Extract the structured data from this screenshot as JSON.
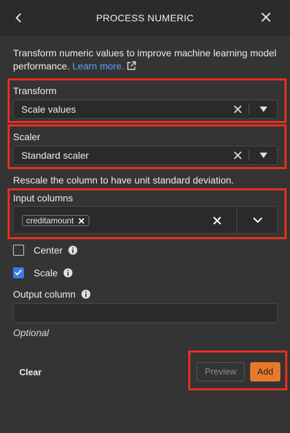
{
  "header": {
    "title": "PROCESS NUMERIC",
    "back_icon": "chevron-left-icon",
    "close_icon": "close-icon"
  },
  "intro": {
    "text": "Transform numeric values to improve machine learning model performance.",
    "link": "Learn more."
  },
  "transform": {
    "label": "Transform",
    "value": "Scale values"
  },
  "scaler": {
    "label": "Scaler",
    "value": "Standard scaler"
  },
  "scaler_description": "Rescale the column to have unit standard deviation.",
  "input_columns": {
    "label": "Input columns",
    "chips": [
      "creditamount"
    ]
  },
  "options": {
    "center": {
      "label": "Center",
      "checked": false
    },
    "scale": {
      "label": "Scale",
      "checked": true
    }
  },
  "output_column": {
    "label": "Output column",
    "value": "",
    "hint": "Optional"
  },
  "footer": {
    "clear": "Clear",
    "preview": "Preview",
    "add": "Add"
  },
  "colors": {
    "accent": "#e8792a",
    "highlight": "#e8301c",
    "link": "#5aa0ff",
    "checkbox": "#3b7be4"
  }
}
